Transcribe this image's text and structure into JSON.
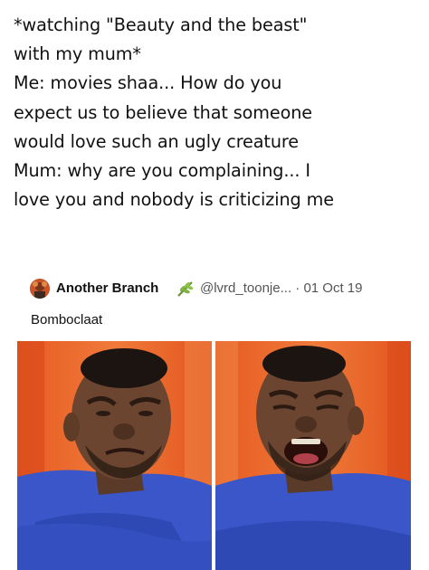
{
  "caption": {
    "lines": [
      "*watching \"Beauty and the beast\"",
      "with my mum*",
      "Me: movies shaa... How do you",
      "expect us to believe that someone",
      "would love such an ugly creature",
      "Mum: why are you complaining... I",
      "love you and nobody is criticizing me"
    ]
  },
  "tweet": {
    "name": "Another Branch",
    "handle_date": "@lvrd_toonje... · 01 Oct 19",
    "text": "Bomboclaat",
    "avatar_icon": "avatar-icon",
    "branch_icon": "leaf-branch-icon"
  },
  "photos": {
    "left_description_color": "#e8622a",
    "right_description_color": "#e8622a"
  }
}
